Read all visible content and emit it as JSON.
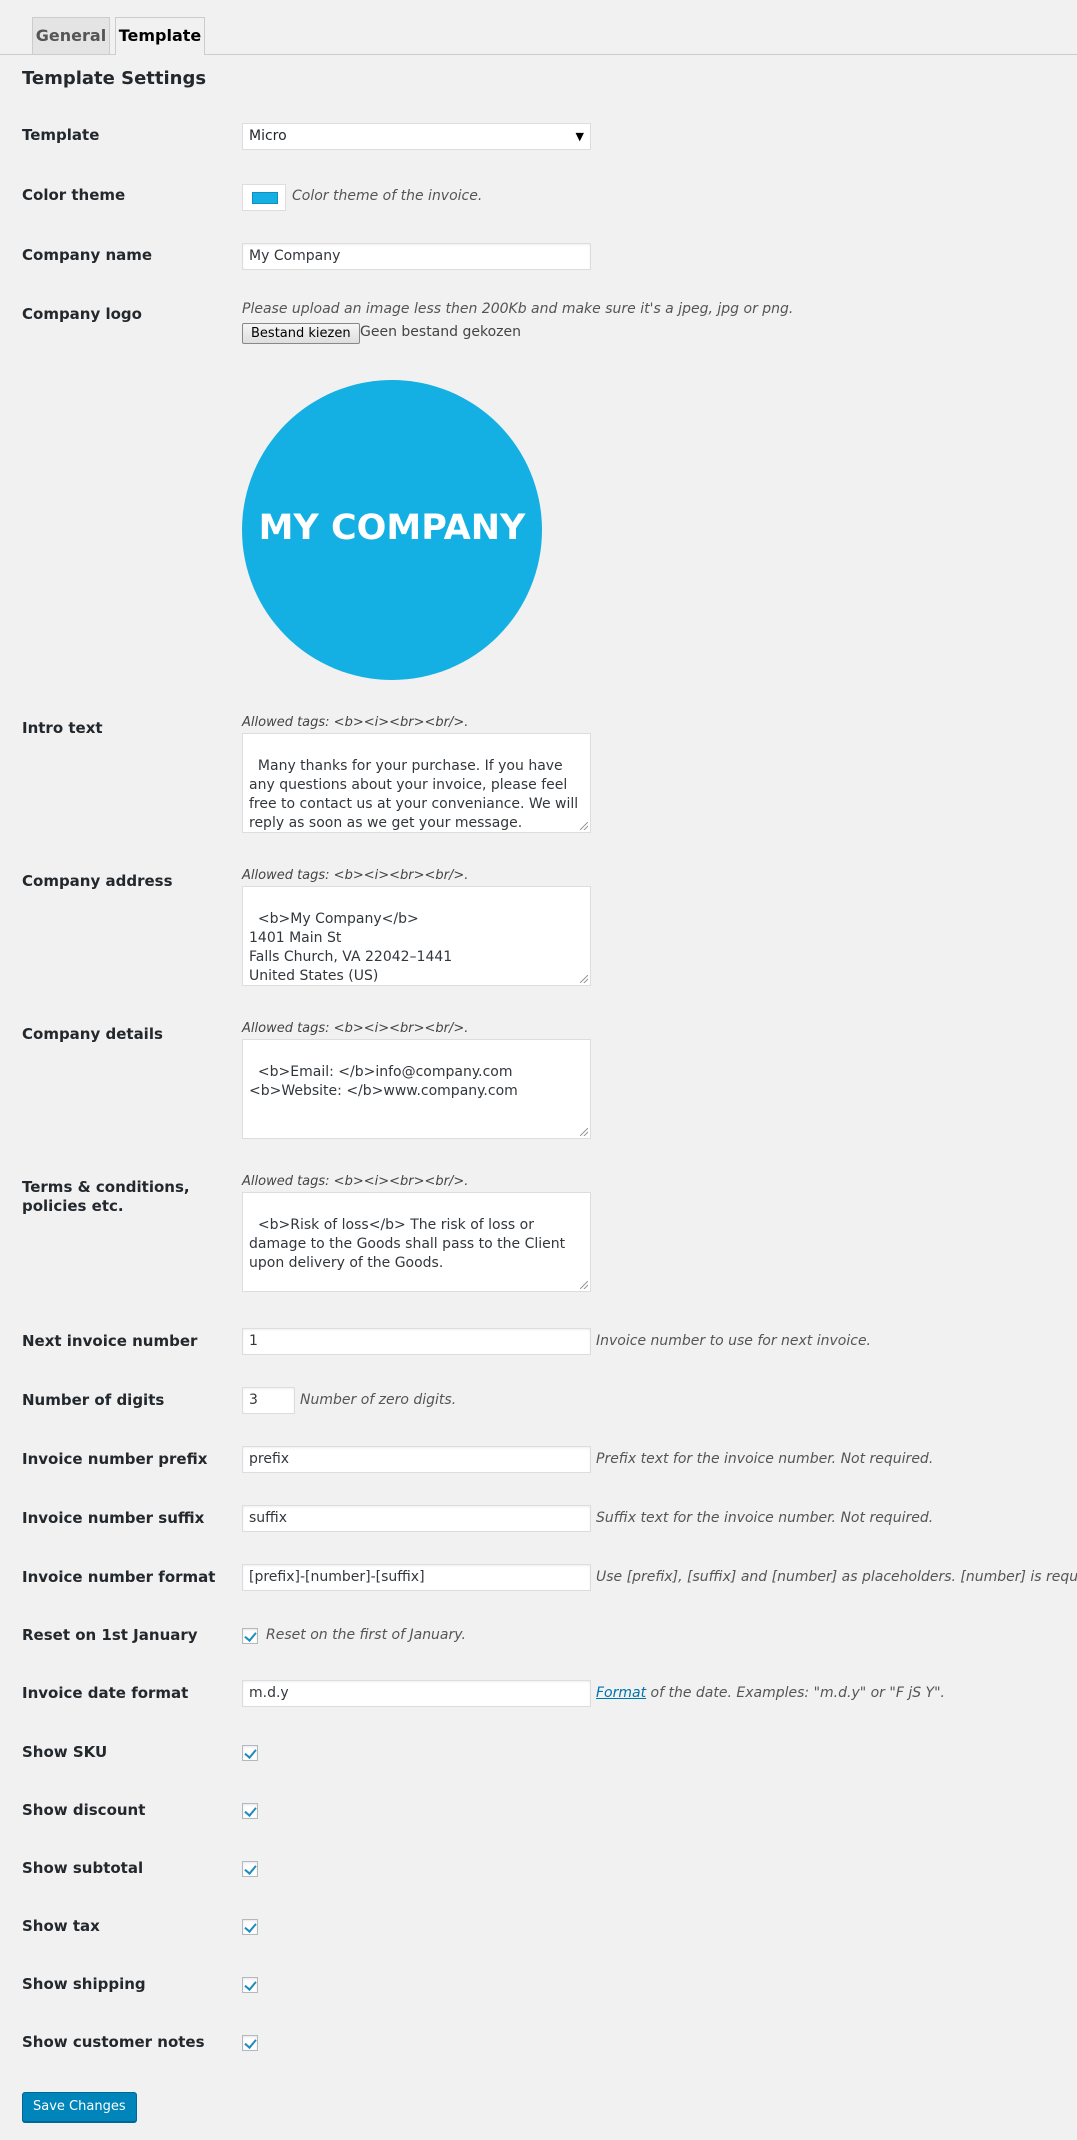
{
  "tabs": [
    {
      "label": "General",
      "active": false
    },
    {
      "label": "Template",
      "active": true
    }
  ],
  "section_title": "Template Settings",
  "template": {
    "label": "Template",
    "value": "Micro"
  },
  "color_theme": {
    "label": "Color theme",
    "color": "#14b0e4",
    "description": "Color theme of the invoice."
  },
  "company_name": {
    "label": "Company name",
    "value": "My Company"
  },
  "company_logo": {
    "label": "Company logo",
    "description": "Please upload an image less then 200Kb and make sure it's a jpeg, jpg or png.",
    "button": "Bestand kiezen",
    "no_file": "Geen bestand gekozen",
    "logo_text": "MY COMPANY",
    "logo_color": "#14b0e4"
  },
  "allowed_tags": "Allowed tags: <b><i><br><br/>.",
  "intro_text": {
    "label": "Intro text",
    "value": "Many thanks for your purchase. If you have any questions about your invoice, please feel free to contact us at your conveniance. We will reply as soon as we get your message."
  },
  "company_address": {
    "label": "Company address",
    "value": "<b>My Company</b>\n1401 Main St\nFalls Church, VA 22042–1441\nUnited States (US)"
  },
  "company_details": {
    "label": "Company details",
    "value": "<b>Email: </b>info@company.com\n<b>Website: </b>www.company.com"
  },
  "terms": {
    "label": "Terms & conditions, policies etc.",
    "value": "<b>Risk of loss</b> The risk of loss or damage to the Goods shall pass to the Client upon delivery of the Goods."
  },
  "next_invoice_number": {
    "label": "Next invoice number",
    "value": "1",
    "description": "Invoice number to use for next invoice."
  },
  "number_of_digits": {
    "label": "Number of digits",
    "value": "3",
    "description": "Number of zero digits."
  },
  "invoice_prefix": {
    "label": "Invoice number prefix",
    "value": "prefix",
    "description": "Prefix text for the invoice number. Not required."
  },
  "invoice_suffix": {
    "label": "Invoice number suffix",
    "value": "suffix",
    "description": "Suffix text for the invoice number. Not required."
  },
  "invoice_format": {
    "label": "Invoice number format",
    "value": "[prefix]-[number]-[suffix]",
    "description": "Use [prefix], [suffix] and [number] as placeholders. [number] is required."
  },
  "reset_january": {
    "label": "Reset on 1st January",
    "checked": true,
    "description": "Reset on the first of January."
  },
  "date_format": {
    "label": "Invoice date format",
    "value": "m.d.y",
    "link": "Format",
    "description": " of the date. Examples: \"m.d.y\" or \"F jS Y\"."
  },
  "show_sku": {
    "label": "Show SKU",
    "checked": true
  },
  "show_discount": {
    "label": "Show discount",
    "checked": true
  },
  "show_subtotal": {
    "label": "Show subtotal",
    "checked": true
  },
  "show_tax": {
    "label": "Show tax",
    "checked": true
  },
  "show_shipping": {
    "label": "Show shipping",
    "checked": true
  },
  "show_customer_notes": {
    "label": "Show customer notes",
    "checked": true
  },
  "save_button": "Save Changes"
}
